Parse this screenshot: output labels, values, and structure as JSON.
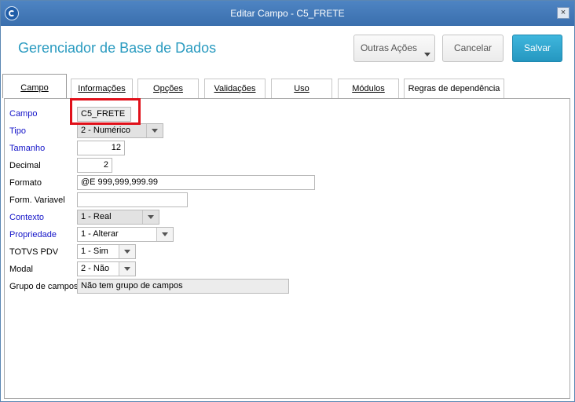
{
  "window": {
    "title": "Editar Campo - C5_FRETE",
    "close_label": "×"
  },
  "header": {
    "app_title": "Gerenciador de Base de Dados",
    "more_actions_label": "Outras Ações",
    "cancel_label": "Cancelar",
    "save_label": "Salvar"
  },
  "tabs": [
    {
      "label": "Campo",
      "active": true
    },
    {
      "label": "Informações"
    },
    {
      "label": "Opções"
    },
    {
      "label": "Validações"
    },
    {
      "label": "Uso"
    },
    {
      "label": "Módulos"
    },
    {
      "label": "Regras de dependência"
    }
  ],
  "form": {
    "campo": {
      "label": "Campo",
      "value": "C5_FRETE"
    },
    "tipo": {
      "label": "Tipo",
      "value": "2 - Numérico"
    },
    "tamanho": {
      "label": "Tamanho",
      "value": "12"
    },
    "decimal": {
      "label": "Decimal",
      "value": "2"
    },
    "formato": {
      "label": "Formato",
      "value": "@E 999,999,999.99"
    },
    "form_variavel": {
      "label": "Form. Variavel",
      "value": ""
    },
    "contexto": {
      "label": "Contexto",
      "value": "1 - Real"
    },
    "propriedade": {
      "label": "Propriedade",
      "value": "1 - Alterar"
    },
    "totvs_pdv": {
      "label": "TOTVS PDV",
      "value": "1 - Sim"
    },
    "modal": {
      "label": "Modal",
      "value": "2 - Não"
    },
    "grupo_campos": {
      "label": "Grupo de campos",
      "value": "Não tem grupo de campos"
    }
  },
  "colors": {
    "title_bar": "#3f76b6",
    "accent": "#2a9bc0",
    "save_button": "#2fa6cf",
    "required_label": "#1414c8",
    "highlight": "#e0101a"
  }
}
